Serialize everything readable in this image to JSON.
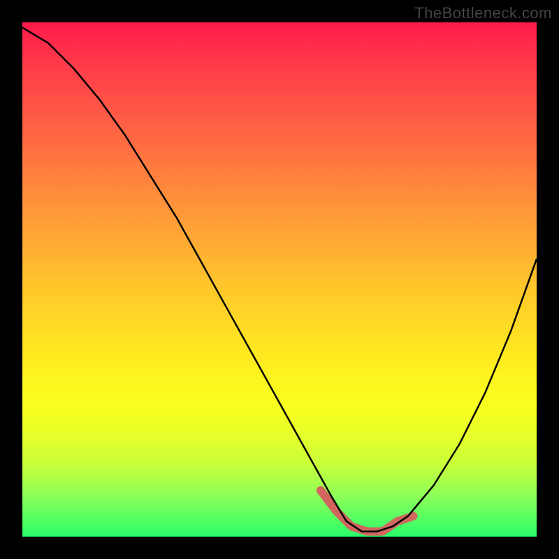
{
  "watermark": "TheBottleneck.com",
  "chart_data": {
    "type": "line",
    "title": "",
    "xlabel": "",
    "ylabel": "",
    "xlim": [
      0,
      100
    ],
    "ylim": [
      0,
      100
    ],
    "series": [
      {
        "name": "bottleneck-curve",
        "x": [
          0,
          5,
          10,
          15,
          20,
          25,
          30,
          35,
          40,
          45,
          50,
          55,
          60,
          63,
          66,
          69,
          72,
          75,
          80,
          85,
          90,
          95,
          100
        ],
        "values": [
          99,
          96,
          91,
          85,
          78,
          70,
          62,
          53,
          44,
          35,
          26,
          17,
          8,
          3,
          1,
          1,
          2,
          4,
          10,
          18,
          28,
          40,
          54
        ]
      },
      {
        "name": "highlight-segment",
        "x": [
          58,
          61,
          64,
          67,
          70,
          73,
          76
        ],
        "values": [
          9,
          5,
          2,
          1,
          1,
          3,
          4
        ]
      }
    ],
    "gradient_sense": "top=worst(red) bottom=best(green)"
  }
}
